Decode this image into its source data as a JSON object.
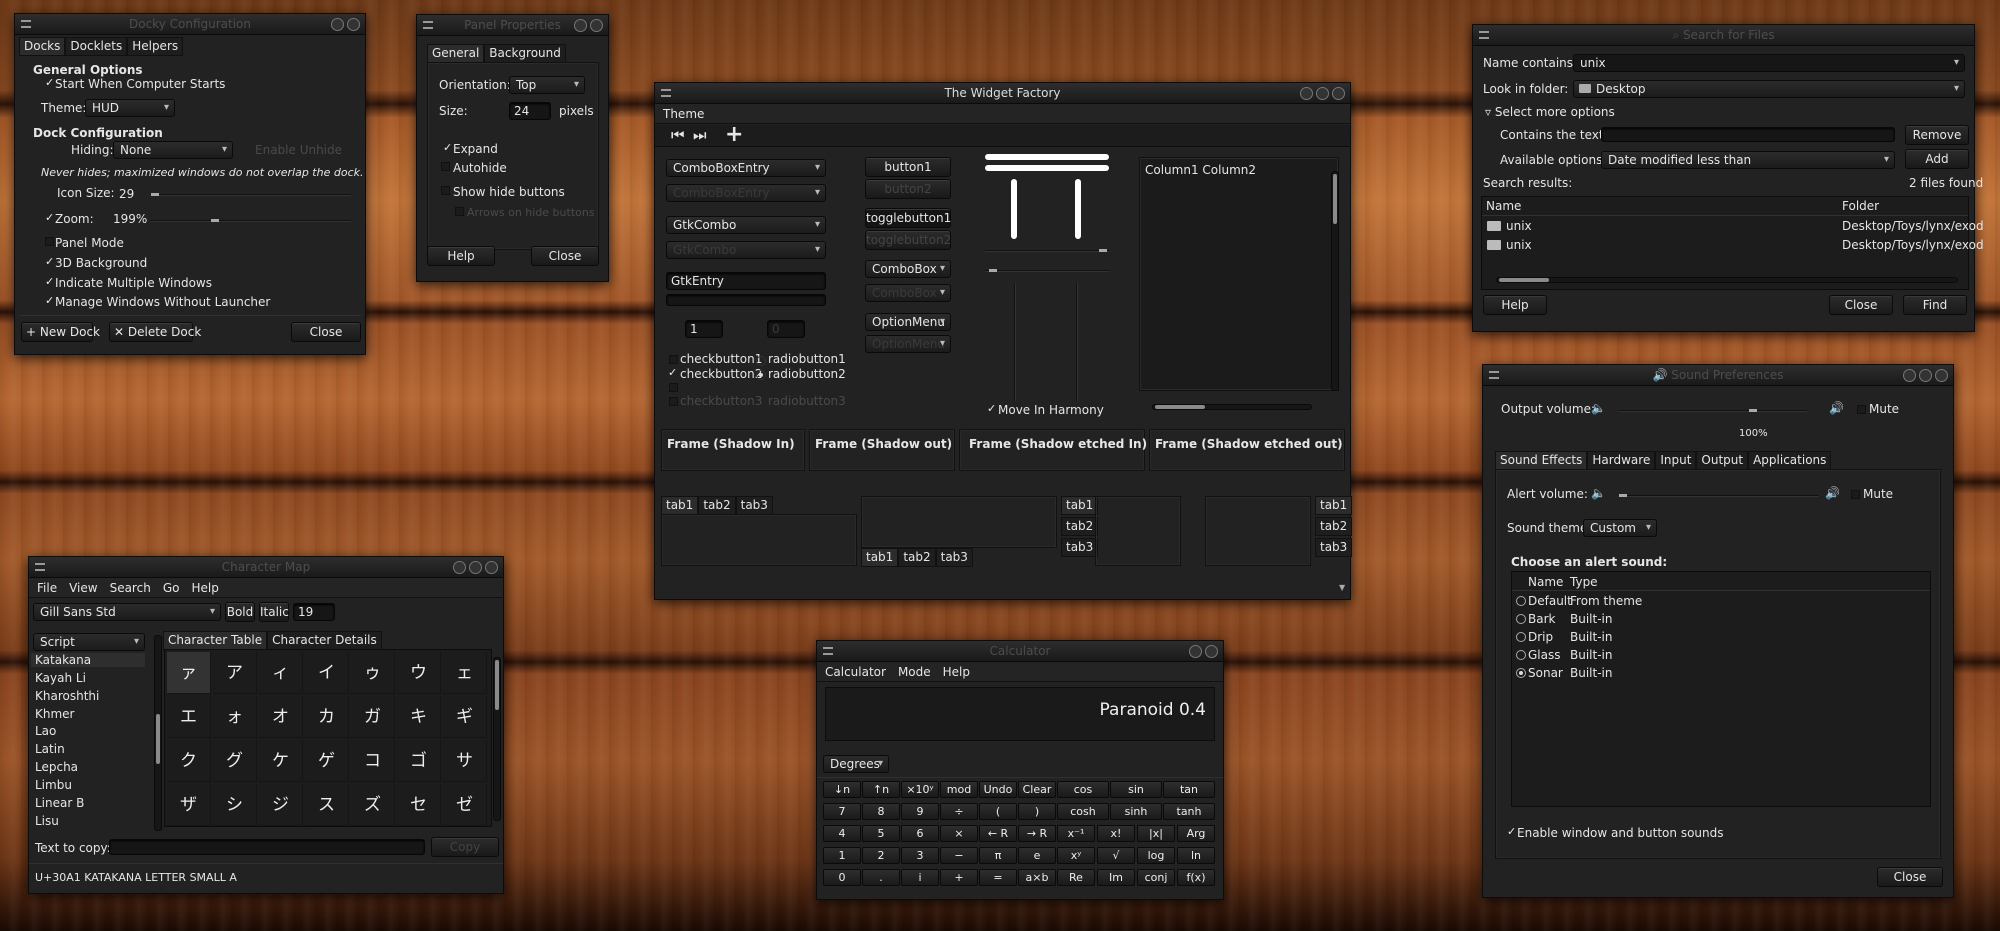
{
  "dock": {
    "title": "Docky Configuration",
    "tabs": [
      "Docks",
      "Docklets",
      "Helpers"
    ],
    "general": "General Options",
    "start": "Start When Computer Starts",
    "theme_label": "Theme:",
    "theme": "HUD",
    "dock_config": "Dock Configuration",
    "hiding_label": "Hiding:",
    "hiding": "None",
    "hiding_dim": "Enable Unhide",
    "note": "Never hides; maximized windows do not overlap the dock.",
    "icon_label": "Icon Size:",
    "icon": "29",
    "zoom_label": "Zoom:",
    "zoom": "199%",
    "panel": "Panel Mode",
    "bg3d": "3D Background",
    "multi": "Indicate Multiple Windows",
    "manage": "Manage Windows Without Launcher",
    "new": "New Dock",
    "del": "Delete Dock",
    "close": "Close"
  },
  "panel": {
    "title": "Panel Properties",
    "tabs": [
      "General",
      "Background"
    ],
    "orient_label": "Orientation:",
    "orient": "Top",
    "size_label": "Size:",
    "size": "24",
    "size_unit": "pixels",
    "expand": "Expand",
    "autohide": "Autohide",
    "showhide": "Show hide buttons",
    "arrows": "Arrows on hide buttons",
    "help": "Help",
    "close": "Close"
  },
  "wf": {
    "title": "The Widget Factory",
    "menu": "Theme",
    "cbe": "ComboBoxEntry",
    "cbe2": "ComboBoxEntry",
    "gtkcombo": "GtkCombo",
    "gtkcombo2": "GtkCombo",
    "gtkentry": "GtkEntry",
    "spin": "1",
    "spin2": "0",
    "check1": "checkbutton1",
    "check2": "checkbutton2",
    "check3": "checkbutton3",
    "radio1": "radiobutton1",
    "radio2": "radiobutton2",
    "radio3": "radiobutton3",
    "button1": "button1",
    "button2": "button2",
    "toggle1": "togglebutton1",
    "toggle2": "togglebutton2",
    "combobox": "ComboBox",
    "combobox2": "ComboBox",
    "optionmenu": "OptionMenu",
    "optionmenu2": "OptionMenu",
    "harmony": "Move In Harmony",
    "list_header": "Column1 Column2",
    "frames": [
      "Frame (Shadow In)",
      "Frame (Shadow out)",
      "Frame (Shadow etched In)",
      "Frame (Shadow etched out)"
    ],
    "tabs": [
      "tab1",
      "tab2",
      "tab3"
    ]
  },
  "charmap": {
    "title": "Character Map",
    "menu": [
      "File",
      "View",
      "Search",
      "Go",
      "Help"
    ],
    "font": "Gill Sans Std",
    "bold": "Bold",
    "italic": "Italic",
    "size": "19",
    "script_label": "Script",
    "scripts": [
      "Katakana",
      "Kayah Li",
      "Kharoshthi",
      "Khmer",
      "Lao",
      "Latin",
      "Lepcha",
      "Limbu",
      "Linear B",
      "Lisu"
    ],
    "tabs": [
      "Character Table",
      "Character Details"
    ],
    "chars": [
      "ァ",
      "ア",
      "ィ",
      "イ",
      "ゥ",
      "ウ",
      "ェ",
      "エ",
      "ォ",
      "オ",
      "カ",
      "ガ",
      "キ",
      "ギ",
      "ク",
      "グ",
      "ケ",
      "ゲ",
      "コ",
      "ゴ",
      "サ",
      "ザ",
      "シ",
      "ジ",
      "ス",
      "ズ",
      "セ",
      "ゼ"
    ],
    "copy_label": "Text to copy:",
    "copy_btn": "Copy",
    "status": "U+30A1 KATAKANA LETTER SMALL A"
  },
  "calc": {
    "title": "Calculator",
    "menu": [
      "Calculator",
      "Mode",
      "Help"
    ],
    "display": "Paranoid 0.4",
    "angle": "Degrees",
    "keys": [
      [
        "↓n",
        "↑n",
        "×10ʸ",
        "mod",
        "Undo",
        "Clear",
        "cos",
        "sin",
        "tan"
      ],
      [
        "7",
        "8",
        "9",
        "÷",
        "(",
        ")",
        "cosh",
        "sinh",
        "tanh"
      ],
      [
        "4",
        "5",
        "6",
        "×",
        "← R",
        "→ R",
        "x⁻¹",
        "x!",
        "|x|",
        "Arg"
      ],
      [
        "1",
        "2",
        "3",
        "−",
        "π",
        "e",
        "xʸ",
        "√",
        "log",
        "ln"
      ],
      [
        "0",
        ".",
        "i",
        "+",
        "=",
        "a×b",
        "Re",
        "Im",
        "conj",
        "f(x)"
      ]
    ]
  },
  "search": {
    "title": "Search for Files",
    "name_label": "Name contains:",
    "name": "unix",
    "look_label": "Look in folder:",
    "look": "Desktop",
    "more": "Select more options",
    "contains_label": "Contains the text:",
    "remove": "Remove",
    "avail_label": "Available options:",
    "avail": "Date modified less than",
    "add": "Add",
    "results_label": "Search results:",
    "count": "2 files found",
    "col_name": "Name",
    "col_folder": "Folder",
    "rows": [
      {
        "name": "unix",
        "folder": "Desktop/Toys/lynx/exod"
      },
      {
        "name": "unix",
        "folder": "Desktop/Toys/lynx/exod"
      }
    ],
    "help": "Help",
    "close": "Close",
    "find": "Find"
  },
  "sound": {
    "title": "Sound Preferences",
    "out_label": "Output volume:",
    "mute": "Mute",
    "pct": "100%",
    "tabs": [
      "Sound Effects",
      "Hardware",
      "Input",
      "Output",
      "Applications"
    ],
    "alert_label": "Alert volume:",
    "theme_label": "Sound theme:",
    "theme": "Custom",
    "choose": "Choose an alert sound:",
    "col_name": "Name",
    "col_type": "Type",
    "sounds": [
      {
        "name": "Default",
        "type": "From theme"
      },
      {
        "name": "Bark",
        "type": "Built-in"
      },
      {
        "name": "Drip",
        "type": "Built-in"
      },
      {
        "name": "Glass",
        "type": "Built-in"
      },
      {
        "name": "Sonar",
        "type": "Built-in"
      }
    ],
    "enable": "Enable window and button sounds",
    "close": "Close"
  }
}
